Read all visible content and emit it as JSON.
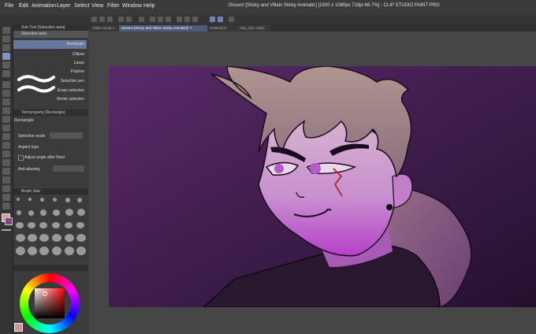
{
  "menu": [
    "File",
    "Edit",
    "Animation",
    "Layer",
    "Select",
    "View",
    "Filter",
    "Window",
    "Help"
  ],
  "window_title": "Dissect [Sticky and Villain Sticky Animatic] [1920 x 1080px 72dpi 66.7%] - CLIP STUDIO PAINT PRO",
  "doc_tabs": [
    "Villain Sticky t...",
    "Dissect [Sticky and Villain Sticky Animatic]* ×",
    "Untitled(c)*",
    "nefy_idk1 Untitl..."
  ],
  "subtool_panel": {
    "title": "Sub Tool [Selection area]",
    "group": "Selection area",
    "items": [
      "Rectangle",
      "Ellipse",
      "Lasso",
      "Polyline",
      "Selection pen",
      "Erase selection",
      "Shrink selection"
    ],
    "selected": "Rectangle"
  },
  "tool_property": {
    "title": "Tool property [Rectangle]",
    "name": "Rectangle",
    "selection_mode": "Selection mode",
    "aspect_type": "Aspect type",
    "adjust_angle": "Adjust angle after fixed",
    "anti_aliasing": "Anti-aliasing"
  },
  "brush_size": {
    "title": "Brush Size"
  },
  "colors": {
    "accent": "#7f94c0",
    "canvas_bg_top": "#5a2a6a",
    "canvas_bg_bottom": "#2b1237",
    "skin_light": "#c9a7c9",
    "skin_dark": "#d46cd6",
    "hair": "#a98c84",
    "main_color": "#d39696"
  }
}
